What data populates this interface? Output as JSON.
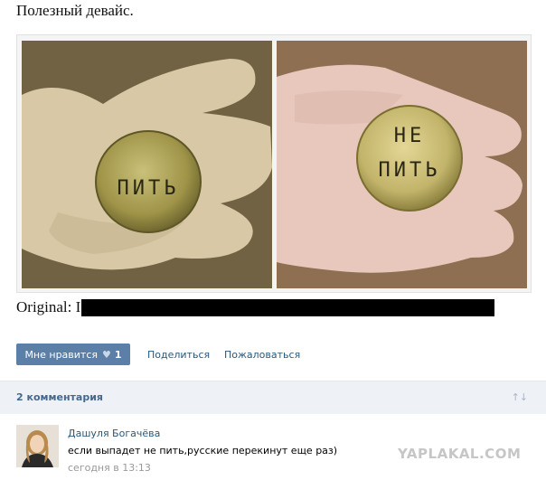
{
  "post": {
    "title": "Полезный девайс.",
    "original_label": "Original: I",
    "photos": [
      {
        "coin_text": [
          "ПИТЬ"
        ]
      },
      {
        "coin_text": [
          "НЕ",
          "ПИТЬ"
        ]
      }
    ]
  },
  "actions": {
    "like_label": "Мне нравится",
    "like_icon": "heart-icon",
    "like_count": "1",
    "share_label": "Поделиться",
    "report_label": "Пожаловаться"
  },
  "comments": {
    "header": "2 комментария",
    "sort_icon": "sort-icon",
    "items": [
      {
        "author": "Дашуля Богачёва",
        "text": "если выпадет не пить,русские перекинут еще раз)",
        "time": "сегодня в 13:13"
      }
    ]
  },
  "watermark": "YAPLAKAL.COM",
  "colors": {
    "link": "#2b587a",
    "like_button": "#5b7fa6",
    "comments_bar": "#eef1f5",
    "comments_header": "#45688e"
  }
}
